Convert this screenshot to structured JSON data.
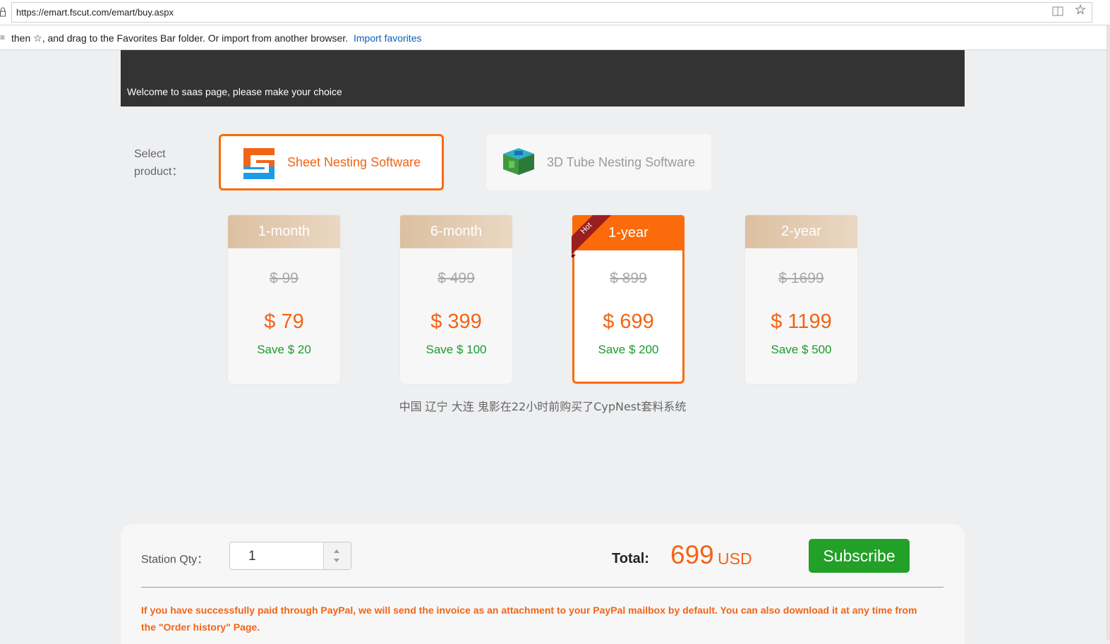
{
  "browser": {
    "url": "https://emart.fscut.com/emart/buy.aspx",
    "favorites_message": "then ☆, and drag to the Favorites Bar folder. Or import from another browser.",
    "favorites_link": "Import favorites"
  },
  "banner": {
    "welcome": "Welcome to saas page, please make your choice"
  },
  "product_select": {
    "label": "Select product：",
    "products": [
      {
        "name": "Sheet Nesting Software",
        "selected": true
      },
      {
        "name": "3D Tube Nesting Software",
        "selected": false
      }
    ]
  },
  "plans": [
    {
      "term": "1-month",
      "original": "$ 99",
      "price": "$ 79",
      "save": "Save $ 20",
      "hot": false
    },
    {
      "term": "6-month",
      "original": "$ 499",
      "price": "$ 399",
      "save": "Save $ 100",
      "hot": false
    },
    {
      "term": "1-year",
      "original": "$ 899",
      "price": "$ 699",
      "save": "Save $ 200",
      "hot": true,
      "badge": "Hot"
    },
    {
      "term": "2-year",
      "original": "$ 1699",
      "price": "$ 1199",
      "save": "Save $ 500",
      "hot": false
    }
  ],
  "recent_purchase": "中国 辽宁 大连 鬼影在22小时前购买了CypNest套料系统",
  "order": {
    "qty_label": "Station Qty：",
    "qty_value": "1",
    "total_label": "Total:",
    "total_amount": "699",
    "currency": "USD",
    "subscribe_label": "Subscribe",
    "invoice_note": "If you have successfully paid through PayPal, we will send the invoice as an attachment to your PayPal mailbox by default. You can also download it at any time from the \"Order history\" Page."
  },
  "colors": {
    "accent": "#fa6a0a",
    "price": "#f36414",
    "save": "#1b9b2a",
    "subscribe": "#22a027",
    "banner": "#333333",
    "plan_header": "#dcc0a0",
    "hot_ribbon": "#9b1f1f"
  }
}
